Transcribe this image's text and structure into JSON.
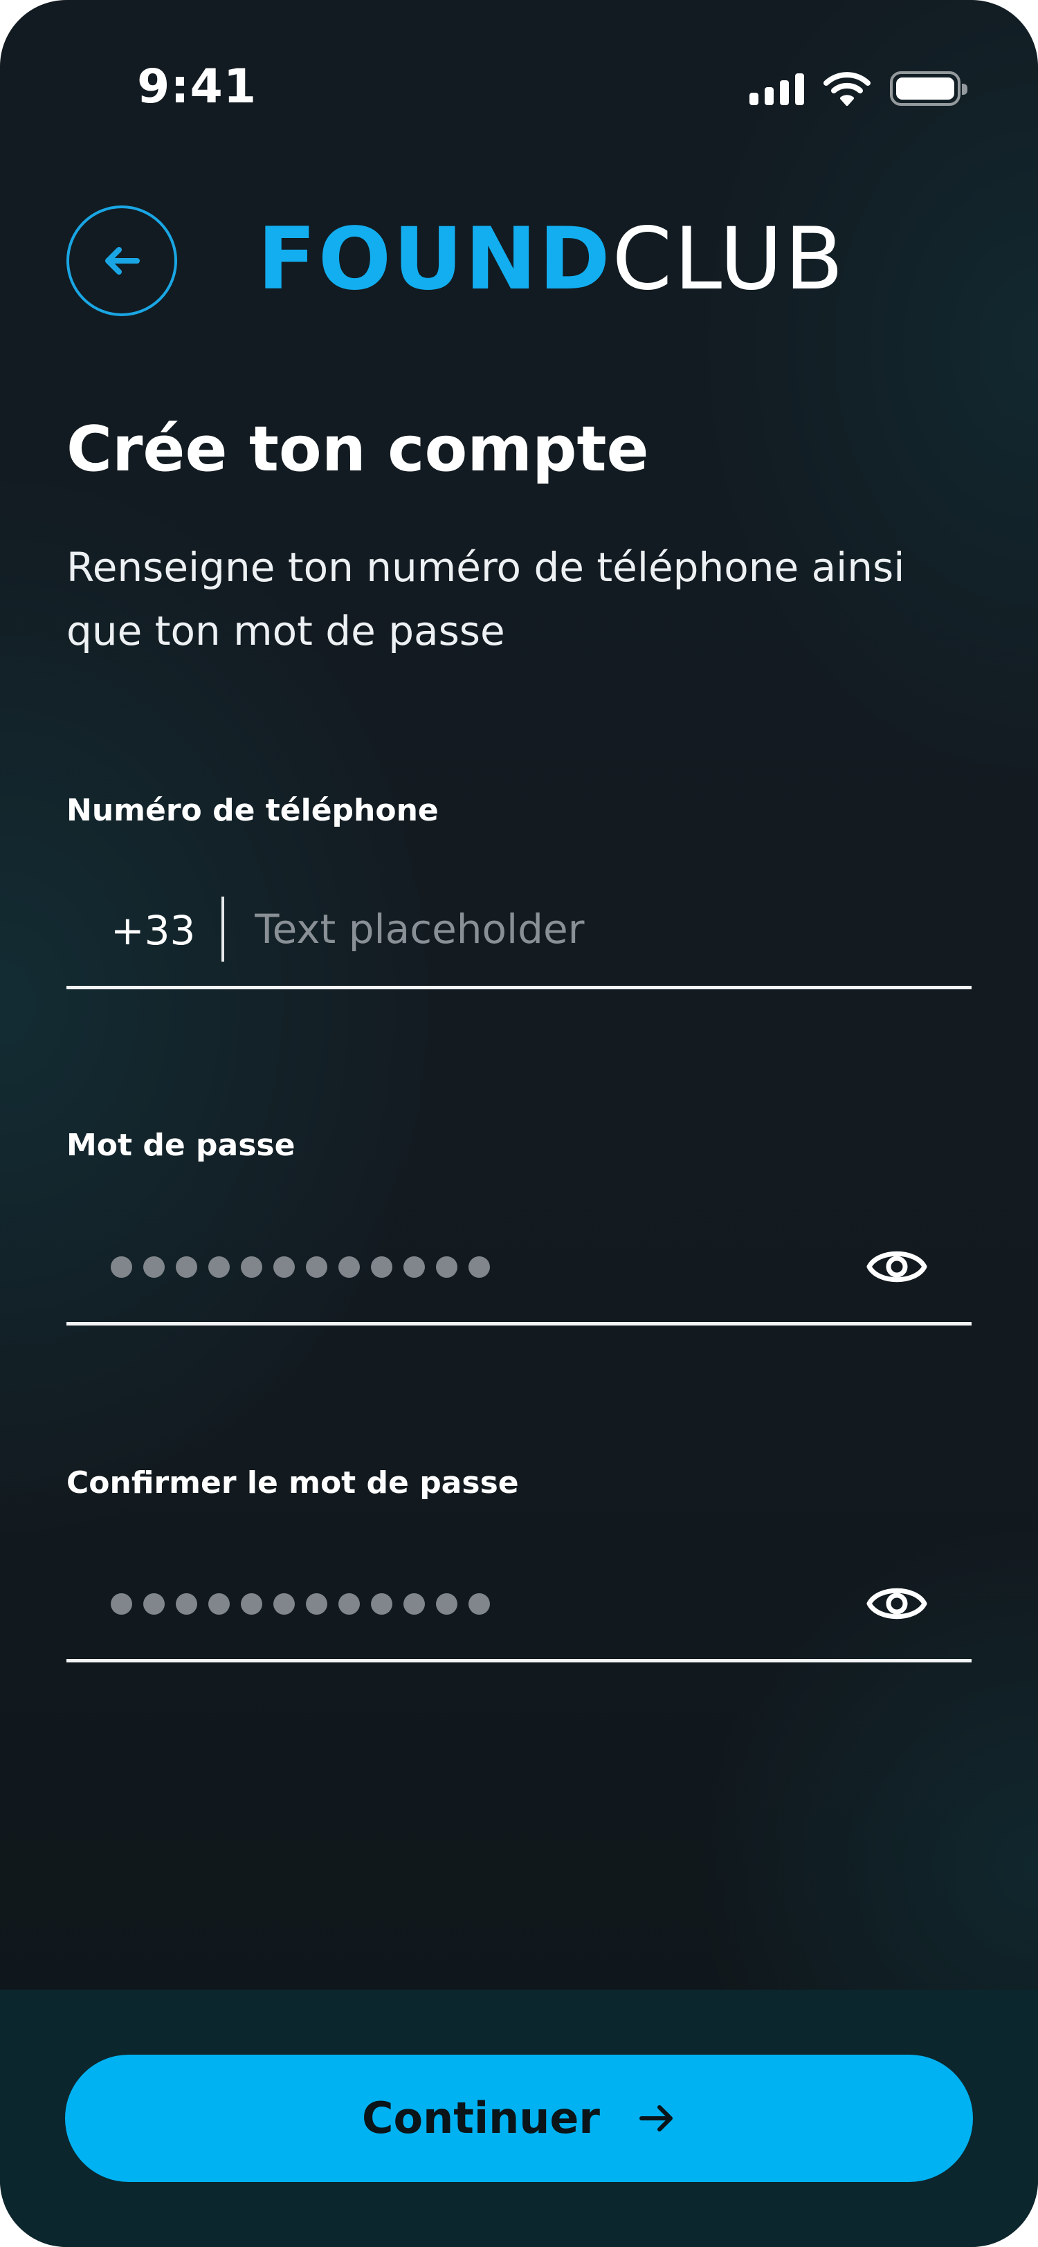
{
  "status_bar": {
    "time": "9:41",
    "icons": [
      "cellular-signal-icon",
      "wifi-icon",
      "battery-icon"
    ]
  },
  "header": {
    "back_icon": "arrow-left-icon",
    "logo_part1": "FOUND",
    "logo_part2": "CLUB"
  },
  "content": {
    "title": "Crée ton compte",
    "subtitle": "Renseigne ton numéro de téléphone ainsi que ton mot de passe"
  },
  "form": {
    "phone": {
      "label": "Numéro de téléphone",
      "prefix": "+33",
      "placeholder": "Text placeholder",
      "value": ""
    },
    "password": {
      "label": "Mot de passe",
      "masked_char_count": 12,
      "toggle_icon": "eye-icon"
    },
    "confirm_password": {
      "label": "Confirmer le mot de passe",
      "masked_char_count": 12,
      "toggle_icon": "eye-icon"
    }
  },
  "footer": {
    "continue_label": "Continuer",
    "continue_icon": "arrow-right-icon"
  },
  "colors": {
    "accent": "#00b2f2",
    "logo_accent": "#12aef0",
    "background": "#131b21",
    "footer_background": "#0c262d",
    "text": "#ffffff",
    "placeholder": "#8a9196"
  }
}
